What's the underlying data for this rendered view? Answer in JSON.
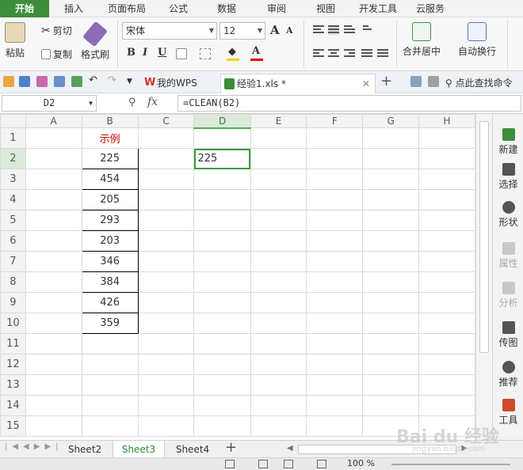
{
  "menu_tabs": [
    {
      "label": "开始",
      "active": true
    },
    {
      "label": "插入"
    },
    {
      "label": "页面布局"
    },
    {
      "label": "公式"
    },
    {
      "label": "数据"
    },
    {
      "label": "审阅"
    },
    {
      "label": "视图"
    },
    {
      "label": "开发工具"
    },
    {
      "label": "云服务"
    }
  ],
  "ribbon": {
    "paste_label": "粘贴",
    "cut_label": "剪切",
    "copy_label": "复制",
    "format_painter_label": "格式刷",
    "font_name": "宋体",
    "font_size": "12",
    "bold": "B",
    "italic": "I",
    "underline": "U",
    "font_color_letter": "A",
    "merge_label": "合并居中",
    "wrap_label": "自动换行",
    "grow_font": "A",
    "shrink_font": "A"
  },
  "quickbar": {
    "wps_tab": "我的WPS",
    "file_tab": "经验1.xls *",
    "search_label": "点此查找命令"
  },
  "formula_bar": {
    "cell_ref": "D2",
    "fx": "fx",
    "formula": "=CLEAN(B2)"
  },
  "columns": [
    "A",
    "B",
    "C",
    "D",
    "E",
    "F",
    "G",
    "H"
  ],
  "rows": [
    "1",
    "2",
    "3",
    "4",
    "5",
    "6",
    "7",
    "8",
    "9",
    "10",
    "11",
    "12",
    "13",
    "14",
    "15"
  ],
  "cells": {
    "B1": "示例",
    "B2": "225",
    "B3": "454",
    "B4": "205",
    "B5": "293",
    "B6": "203",
    "B7": "346",
    "B8": "384",
    "B9": "426",
    "B10": "359",
    "D2": "225"
  },
  "side_panel": [
    {
      "label": "新建"
    },
    {
      "label": "选择"
    },
    {
      "label": "形状"
    },
    {
      "label": "属性",
      "disabled": true
    },
    {
      "label": "分析",
      "disabled": true
    },
    {
      "label": "传图"
    },
    {
      "label": "推荐"
    },
    {
      "label": "工具"
    }
  ],
  "sheet_tabs": [
    {
      "label": "Sheet2"
    },
    {
      "label": "Sheet3",
      "active": true
    },
    {
      "label": "Sheet4"
    }
  ],
  "status": {
    "zoom": "100 %"
  },
  "watermark": {
    "text": "Bai du 经验",
    "url": "jingyan.baidu.com"
  },
  "colors": {
    "accent": "#3c8d3c",
    "header_red": "#d00000"
  }
}
